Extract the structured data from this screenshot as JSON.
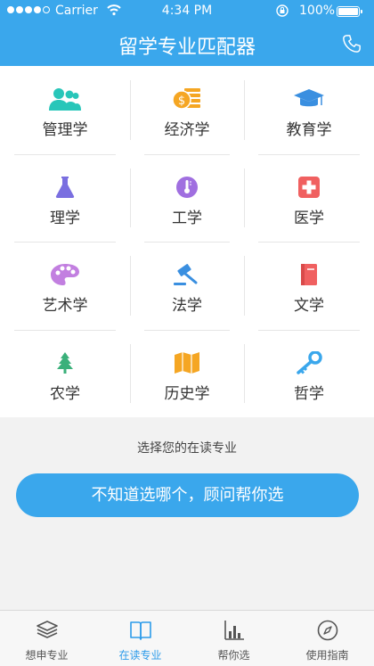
{
  "status_bar": {
    "carrier": "Carrier",
    "time": "4:34 PM",
    "battery": "100%"
  },
  "header": {
    "title": "留学专业匹配器",
    "phone_icon": "phone-icon"
  },
  "majors": [
    {
      "label": "管理学",
      "icon": "people-icon",
      "color": "#28c6b9"
    },
    {
      "label": "经济学",
      "icon": "coins-icon",
      "color": "#f5a623"
    },
    {
      "label": "教育学",
      "icon": "graduation-cap-icon",
      "color": "#3a8fe0"
    },
    {
      "label": "理学",
      "icon": "flask-icon",
      "color": "#7a6fe0"
    },
    {
      "label": "工学",
      "icon": "thermometer-icon",
      "color": "#a06fe0"
    },
    {
      "label": "医学",
      "icon": "medical-cross-icon",
      "color": "#f06060"
    },
    {
      "label": "艺术学",
      "icon": "palette-icon",
      "color": "#c27fe0"
    },
    {
      "label": "法学",
      "icon": "gavel-icon",
      "color": "#3a8fe0"
    },
    {
      "label": "文学",
      "icon": "book-icon",
      "color": "#f06060"
    },
    {
      "label": "农学",
      "icon": "tree-icon",
      "color": "#3ab07a"
    },
    {
      "label": "历史学",
      "icon": "map-icon",
      "color": "#f5a623"
    },
    {
      "label": "哲学",
      "icon": "key-icon",
      "color": "#3aa7ec"
    }
  ],
  "prompt": "选择您的在读专业",
  "advisor_button": "不知道选哪个，顾问帮你选",
  "tabs": [
    {
      "label": "想申专业",
      "icon": "layers-icon",
      "active": false
    },
    {
      "label": "在读专业",
      "icon": "open-book-icon",
      "active": true
    },
    {
      "label": "帮你选",
      "icon": "bar-chart-icon",
      "active": false
    },
    {
      "label": "使用指南",
      "icon": "compass-icon",
      "active": false
    }
  ],
  "colors": {
    "accent": "#3aa7ec",
    "tab_active": "#2c9bea"
  }
}
